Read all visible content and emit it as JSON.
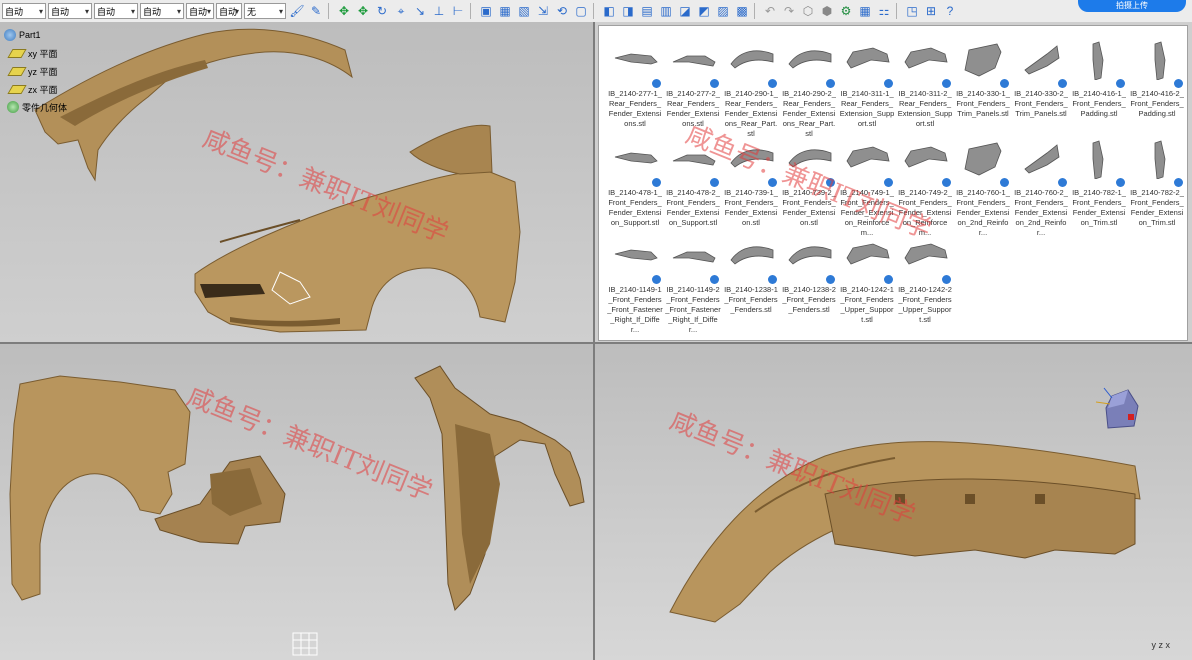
{
  "toolbar": {
    "selects": [
      "自动",
      "自动",
      "自动",
      "自动",
      "自动",
      "自动",
      "无"
    ],
    "upload_label": "拍摄上传"
  },
  "tree": {
    "root": "Part1",
    "items": [
      "xy 平面",
      "yz 平面",
      "zx 平面",
      "零件几何体"
    ]
  },
  "files": [
    "IB_2140-277-1_Rear_Fenders_Fender_Extensions.stl",
    "IB_2140-277-2_Rear_Fenders_Fender_Extensions.stl",
    "IB_2140-290-1_Rear_Fenders_Fender_Extensions_Rear_Part.stl",
    "IB_2140-290-2_Rear_Fenders_Fender_Extensions_Rear_Part.stl",
    "IB_2140-311-1_Rear_Fenders_Extension_Support.stl",
    "IB_2140-311-2_Rear_Fenders_Extension_Support.stl",
    "IB_2140-330-1_Front_Fenders_Trim_Panels.stl",
    "IB_2140-330-2_Front_Fenders_Trim_Panels.stl",
    "IB_2140-416-1_Front_Fenders_Padding.stl",
    "IB_2140-416-2_Front_Fenders_Padding.stl",
    "IB_2140-478-1_Front_Fenders_Fender_Extension_Support.stl",
    "IB_2140-478-2_Front_Fenders_Fender_Extension_Support.stl",
    "IB_2140-739-1_Front_Fenders_Fender_Extension.stl",
    "IB_2140-739-2_Front_Fenders_Fender_Extension.stl",
    "IB_2140-749-1_Front_Fenders_Fender_Extension_Reinforcem...",
    "IB_2140-749-2_Front_Fenders_Fender_Extension_Reinforcem...",
    "IB_2140-760-1_Front_Fenders_Fender_Extension_2nd_Reinfor...",
    "IB_2140-760-2_Front_Fenders_Fender_Extension_2nd_Reinfor...",
    "IB_2140-782-1_Front_Fenders_Fender_Extension_Trim.stl",
    "IB_2140-782-2_Front_Fenders_Fender_Extension_Trim.stl",
    "IB_2140-1149-1_Front_Fenders_Front_Fastener_Right_If_Differ...",
    "IB_2140-1149-2_Front_Fenders_Front_Fastener_Right_If_Differ...",
    "IB_2140-1238-1_Front_Fenders_Fenders.stl",
    "IB_2140-1238-2_Front_Fenders_Fenders.stl",
    "IB_2140-1242-1_Front_Fenders_Upper_Support.stl",
    "IB_2140-1242-2_Front_Fenders_Upper_Support.stl"
  ],
  "watermark": "咸鱼号：兼职IT刘同学",
  "axes": {
    "x": "x",
    "y": "y",
    "z": "z"
  },
  "colors": {
    "part": "#b8955f",
    "part_dark": "#8a6a3a",
    "badge": "#2e7ad6"
  }
}
